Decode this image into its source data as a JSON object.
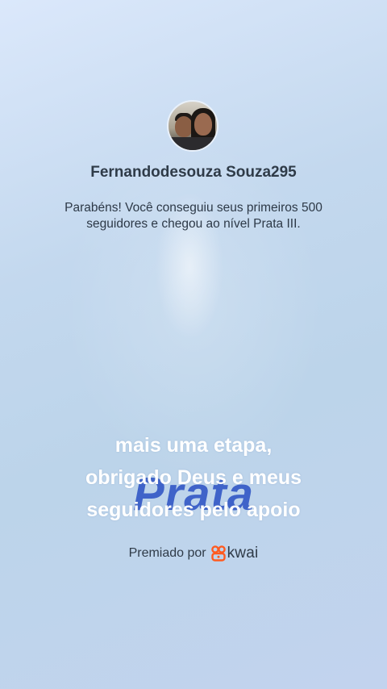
{
  "profile": {
    "username": "Fernandodesouza Souza295",
    "avatar_description": "avatar"
  },
  "message": "Parabéns! Você conseguiu seus primeiros 500 seguidores e chegou ao nível Prata III.",
  "badge": {
    "level_word": "Prata"
  },
  "caption": {
    "lines": [
      "mais uma etapa,",
      "obrigado Deus e meus",
      "seguidores pelo apoio"
    ]
  },
  "footer": {
    "label": "Premiado por",
    "brand": "kwai",
    "brand_icon": "kwai-logo-icon",
    "brand_color": "#ff5a1f"
  }
}
